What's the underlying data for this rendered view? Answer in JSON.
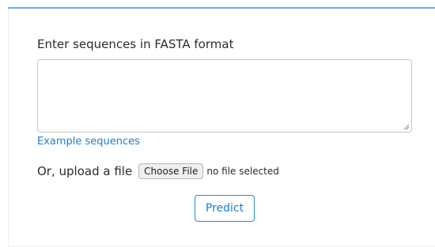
{
  "form": {
    "sequence_label": "Enter sequences in FASTA format",
    "sequence_value": "",
    "example_link": "Example sequences",
    "upload_label": "Or, upload a file",
    "choose_file_label": "Choose File",
    "file_status": "no file selected",
    "predict_label": "Predict"
  },
  "colors": {
    "accent": "#1f7fc4",
    "top_rule": "#6fa7e6"
  },
  "icons": {
    "resize_grip": "resize-grip-icon"
  }
}
